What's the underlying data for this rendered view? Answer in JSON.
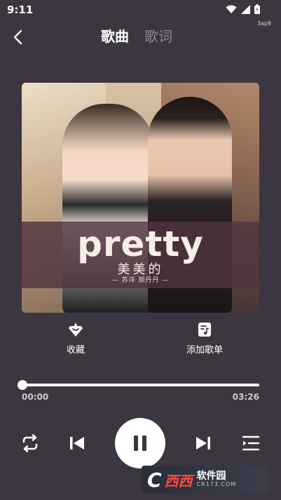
{
  "status_bar": {
    "time": "9:11",
    "tag": "3ap9",
    "icons": [
      "wifi-icon",
      "signal-icon",
      "battery-icon"
    ]
  },
  "header": {
    "tabs": [
      {
        "label": "歌曲",
        "active": true
      },
      {
        "label": "歌词",
        "active": false
      }
    ]
  },
  "album": {
    "title": "pretty",
    "subtitle": "美美的",
    "artists": "— 苏洋 胡丹丹 —"
  },
  "actions": [
    {
      "label": "收藏",
      "icon": "favorite-icon"
    },
    {
      "label": "添加歌单",
      "icon": "add-playlist-icon"
    }
  ],
  "progress": {
    "current_time": "00:00",
    "total_time": "03:26",
    "fraction": 0.0
  },
  "controls": {
    "icons": [
      "repeat-icon",
      "previous-icon",
      "pause-icon",
      "next-icon",
      "playlist-icon"
    ]
  },
  "watermark": {
    "logo_letter": "C",
    "brand": "西西",
    "site_name": "软件园",
    "url": "CR173.COM"
  },
  "colors": {
    "background": "#3c3640",
    "accent": "#ffffff",
    "inactive_tab": "#8e8793"
  }
}
